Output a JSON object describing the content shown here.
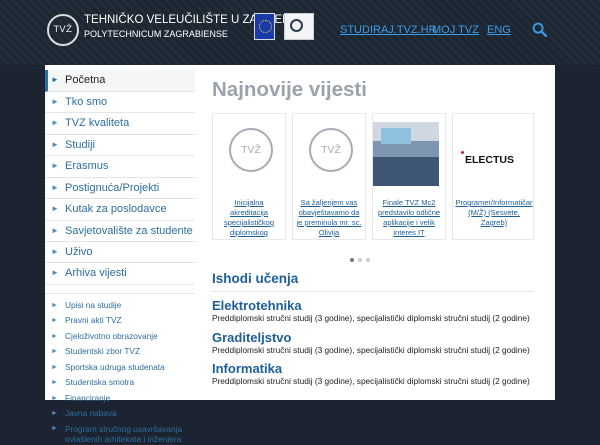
{
  "header": {
    "logo_mark": "TVŽ",
    "line1": "TEHNIČKO VELEUČILIŠTE U ZAGREBU",
    "line2": "POLYTECHNICUM ZAGRABIENSE",
    "links": [
      "STUDIRAJ.TVZ.HR",
      "MOJ TVZ",
      "ENG"
    ],
    "accent": "#3e9be6"
  },
  "sidebar": {
    "items": [
      "Početna",
      "Tko smo",
      "TVZ kvaliteta",
      "Studiji",
      "Erasmus",
      "Postignuća/Projekti",
      "Kutak za poslodavce",
      "Savjetovalište za studente",
      "Uživo",
      "Arhiva vijesti"
    ],
    "sub_items": [
      "Upisi na studije",
      "Pravni akti TVZ",
      "Cjeloživotno obrazovanje",
      "Studentski zbor TVZ",
      "Sportska udruga studenata",
      "Studentska smotra",
      "Financiranje",
      "Javna nabava",
      "Program stručnog usavršavanja ovlaštenih arhitekata i inženjera"
    ]
  },
  "news": {
    "title": "Najnovije vijesti",
    "cards": [
      {
        "caption": "Inicijalna akreditacija specijalističkog diplomskog stručnog",
        "thumb_text": "TVŽ"
      },
      {
        "caption": "Sa žaljenjem vas obavještavamo da je preminula mr. sc. Olivija",
        "thumb_text": "TVŽ"
      },
      {
        "caption": "Finale TVZ Mc2 predstavilo odlične aplikacije i velik interes IT",
        "thumb_text": ""
      },
      {
        "caption": "Programer/Informatičar (M/Ž) (Sesvete, Zagreb)",
        "thumb_text": "ELECTUS"
      }
    ]
  },
  "outcomes": {
    "title": "Ishodi učenja",
    "programs": [
      {
        "name": "Elektrotehnika",
        "desc": "Preddiplomski stručni studij (3 godine), specijalistički diplomski stručni studij (2 godine)"
      },
      {
        "name": "Graditeljstvo",
        "desc": "Preddiplomski stručni studij (3 godine), specijalistički diplomski stručni studij (2 godine)"
      },
      {
        "name": "Informatika",
        "desc": "Preddiplomski stručni studij (3 godine), specijalistički diplomski stručni studij (2 godine)"
      }
    ]
  }
}
